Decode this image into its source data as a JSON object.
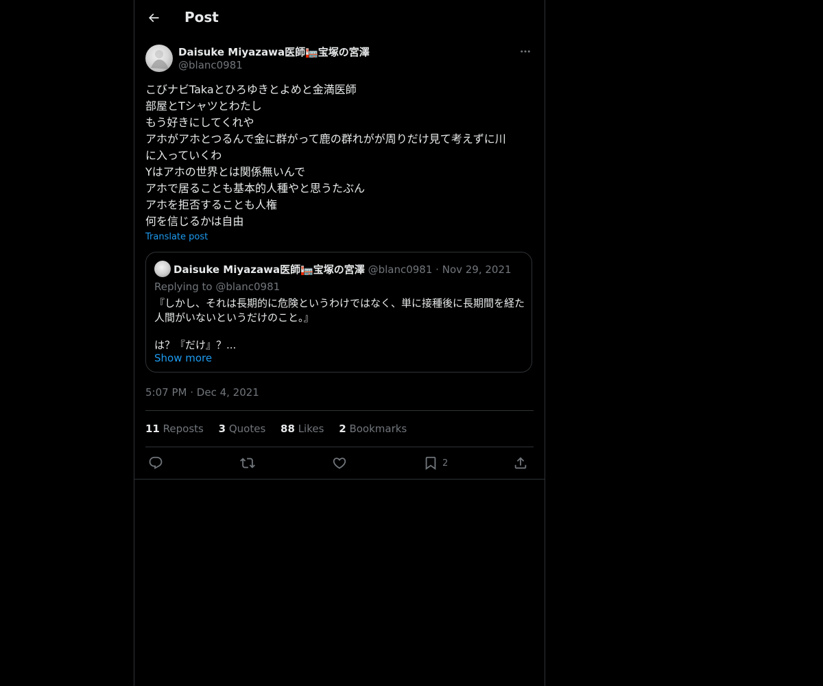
{
  "header": {
    "title": "Post",
    "back_icon": "arrow-left-icon"
  },
  "author": {
    "name": "Daisuke Miyazawa医師🏣宝塚の宮澤",
    "handle": "@blanc0981"
  },
  "post": {
    "lines": [
      "こびナビTakaとひろゆきとよめと金満医師",
      "部屋とTシャツとわたし",
      "もう好きにしてくれや",
      "アホがアホとつるんで金に群がって鹿の群れがが周りだけ見て考えずに川",
      "に入っていくわ",
      "Yはアホの世界とは関係無いんで",
      "アホで居ることも基本的人種やと思うたぶん",
      "アホを拒否することも人権",
      "何を信じるかは自由"
    ],
    "translate": "Translate post"
  },
  "quote": {
    "name": "Daisuke Miyazawa医師🏣宝塚の宮澤",
    "handle": "@blanc0981",
    "separator": "·",
    "date": "Nov 29, 2021",
    "replying_prefix": "Replying to ",
    "replying_to": "@blanc0981",
    "body": "『しかし、それは長期的に危険というわけではなく、単に接種後に長期間を経た人間がいないというだけのこと。』",
    "body2": "は？『だけ』？...",
    "show_more": "Show more"
  },
  "meta": {
    "time": "5:07 PM",
    "separator": "·",
    "date": "Dec 4, 2021"
  },
  "stats": [
    {
      "num": "11",
      "label": "Reposts"
    },
    {
      "num": "3",
      "label": "Quotes"
    },
    {
      "num": "88",
      "label": "Likes"
    },
    {
      "num": "2",
      "label": "Bookmarks"
    }
  ],
  "actions": {
    "reply_icon": "reply-icon",
    "repost_icon": "repost-icon",
    "like_icon": "heart-icon",
    "bookmark_icon": "bookmark-icon",
    "bookmark_count": "2",
    "share_icon": "share-icon"
  },
  "colors": {
    "background": "#000000",
    "text": "#e7e9ea",
    "muted": "#71767b",
    "accent": "#1d9bf0",
    "border": "#2f3336"
  }
}
